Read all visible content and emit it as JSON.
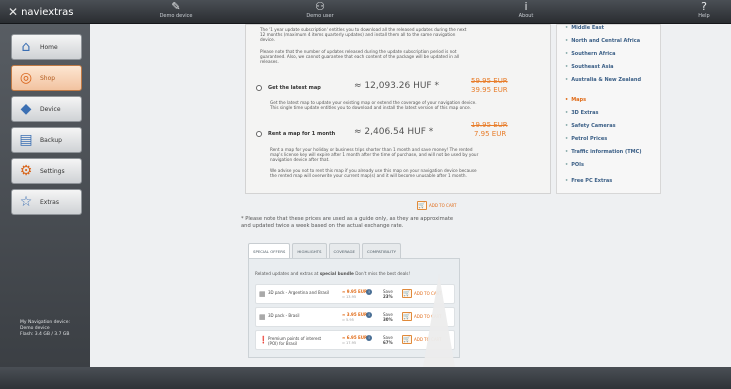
{
  "app": {
    "logo_text": "naviextras"
  },
  "topbar": {
    "buttons": [
      {
        "label": "Demo device",
        "icon": "wrench-icon"
      },
      {
        "label": "Demo user",
        "icon": "user-icon"
      },
      {
        "label": "About",
        "icon": "info-icon"
      },
      {
        "label": "Help",
        "icon": "help-icon"
      }
    ]
  },
  "sidebar": {
    "items": [
      {
        "label": "Home",
        "icon": "home-icon"
      },
      {
        "label": "Shop",
        "icon": "shop-icon",
        "active": true
      },
      {
        "label": "Device",
        "icon": "device-icon"
      },
      {
        "label": "Backup",
        "icon": "backup-icon"
      },
      {
        "label": "Settings",
        "icon": "settings-icon"
      },
      {
        "label": "Extras",
        "icon": "star-icon"
      }
    ],
    "device_info": {
      "line1": "My Navigation device:",
      "line2": "Demo device",
      "line3": "Flash: 3.4 GB / 3.7 GB"
    }
  },
  "offer_panel": {
    "top_text_1": "The '1 year update subscription' entitles you to download all the released updates during the next 12 months (maximum 4 items quarterly updates) and install them all to the same navigation device.",
    "top_text_2": "Please note that the number of updates released during the update subscription period is not guaranteed. Also, we cannot guarantee that each content of the package will be updated in all releases.",
    "latest": {
      "label": "Get the latest map",
      "price_huf": "≈ 12,093.26 HUF *",
      "old_price": "59.95 EUR",
      "new_price": "39.95 EUR",
      "desc": "Get the latest map to update your existing map or extend the coverage of your navigation device. This single time update entitles you to download and install the latest version of this map once."
    },
    "rent": {
      "label": "Rent a map for 1 month",
      "price_huf": "≈ 2,406.54 HUF *",
      "old_price": "19.95 EUR",
      "new_price": "7.95 EUR",
      "desc_1": "Rent a map for your holiday or business trips shorter than 1 month and save money! The rented map's license key will expire after 1 month after the time of purchase, and will not be used by your navigation device after that.",
      "desc_2": "We advise you not to rent this map if you already use this map on your navigation device because the rented map will overwrite your current map(s) and it will become unusable after 1 month."
    }
  },
  "right_list": {
    "items": [
      {
        "label": "Middle East"
      },
      {
        "label": "North and Central Africa"
      },
      {
        "label": "Southern Africa"
      },
      {
        "label": "Southeast Asia"
      },
      {
        "label": "Australia & New Zealand"
      },
      {
        "label": "Maps",
        "active": true
      },
      {
        "label": "3D Extras"
      },
      {
        "label": "Safety Cameras"
      },
      {
        "label": "Petrol Prices"
      },
      {
        "label": "Traffic information (TMC)"
      },
      {
        "label": "POIs"
      },
      {
        "label": "Free PC Extras"
      }
    ]
  },
  "add_to_cart_label": "ADD TO CART",
  "price_note": "* Please note that these prices are used as a guide only, as they are approximate and updated twice a week based on the actual exchange rate.",
  "tabs": [
    {
      "label": "SPECIAL OFFERS",
      "active": true
    },
    {
      "label": "HIGHLIGHTS"
    },
    {
      "label": "COVERAGE"
    },
    {
      "label": "COMPATIBILITY"
    }
  ],
  "special_offers": {
    "intro_prefix": "Related updates and extras at",
    "intro_bold": "special bundle",
    "intro_suffix": "Don't miss the best deals!",
    "deals": [
      {
        "name": "3D pack - Argentina and Brasil",
        "price": "≈ 9.95 EUR",
        "old_price": "≈ 13.95",
        "save_label": "Save",
        "save_value": "23%"
      },
      {
        "name": "3D pack - Brasil",
        "price": "≈ 3.95 EUR",
        "old_price": "≈ 5.95",
        "save_label": "Save",
        "save_value": "30%"
      },
      {
        "name": "Premium points of interest (POI) for Brasil",
        "price": "≈ 6.95 EUR",
        "old_price": "≈ 17.95",
        "save_label": "Save",
        "save_value": "67%"
      }
    ]
  },
  "colors": {
    "accent": "#e06a16",
    "link": "#3b5f86",
    "sidebar_bg": "#4a4f55"
  }
}
